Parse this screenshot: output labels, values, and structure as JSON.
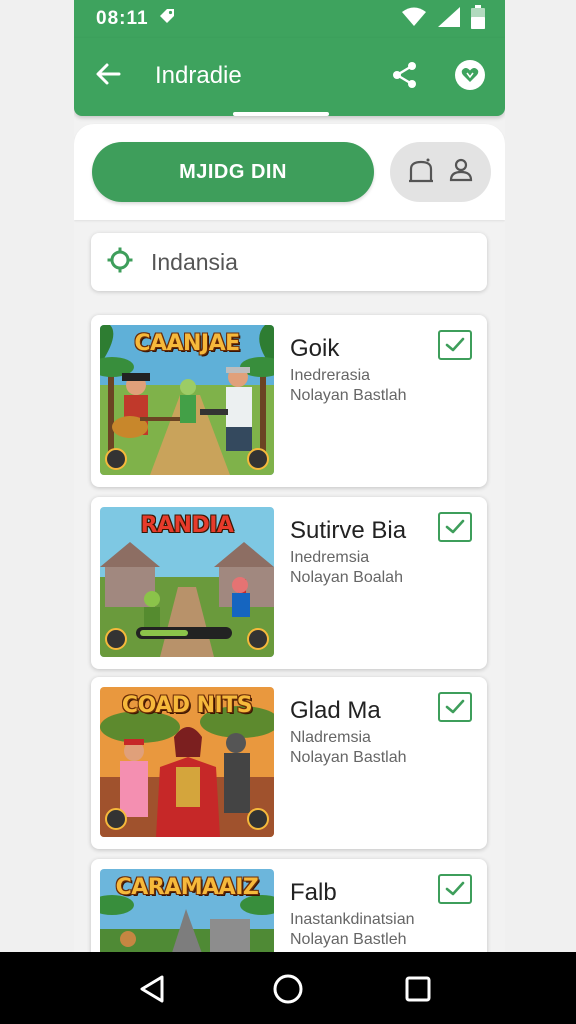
{
  "status_bar": {
    "time": "08:11",
    "icons": [
      "tag-icon",
      "wifi-icon",
      "signal-icon",
      "battery-icon"
    ]
  },
  "app_bar": {
    "title": "Indradie",
    "icons": [
      "back-arrow-icon",
      "share-icon",
      "heart-icon"
    ]
  },
  "actions": {
    "primary_label": "MJIDG DIN",
    "toggle_icons": [
      "home-icon",
      "person-icon"
    ]
  },
  "search": {
    "value": "Indansia",
    "icon": "gear-icon"
  },
  "cards": [
    {
      "thumb_title": "CAANJAE",
      "title": "Goik",
      "line1": "Inedrerasia",
      "line2": "Nolayan Bastlah",
      "checked": true
    },
    {
      "thumb_title": "RANDIA",
      "title": "Sutirve Bia",
      "line1": "Inedremsia",
      "line2": "Nolayan Boalah",
      "checked": true
    },
    {
      "thumb_title": "COAD NITS",
      "title": "Glad Ma",
      "line1": "Nladremsia",
      "line2": "Nolayan Bastlah",
      "checked": true
    },
    {
      "thumb_title": "CARAMAAIZ",
      "title": "Falb",
      "line1": "Inastankdinatsian",
      "line2": "Nolayan Bastleh",
      "checked": true
    }
  ],
  "colors": {
    "brand_green": "#3ea35e",
    "button_green": "#3e9e5b",
    "background": "#f2f2f2"
  },
  "nav_bar": {
    "icons": [
      "back-triangle-icon",
      "home-circle-icon",
      "recents-square-icon"
    ]
  }
}
